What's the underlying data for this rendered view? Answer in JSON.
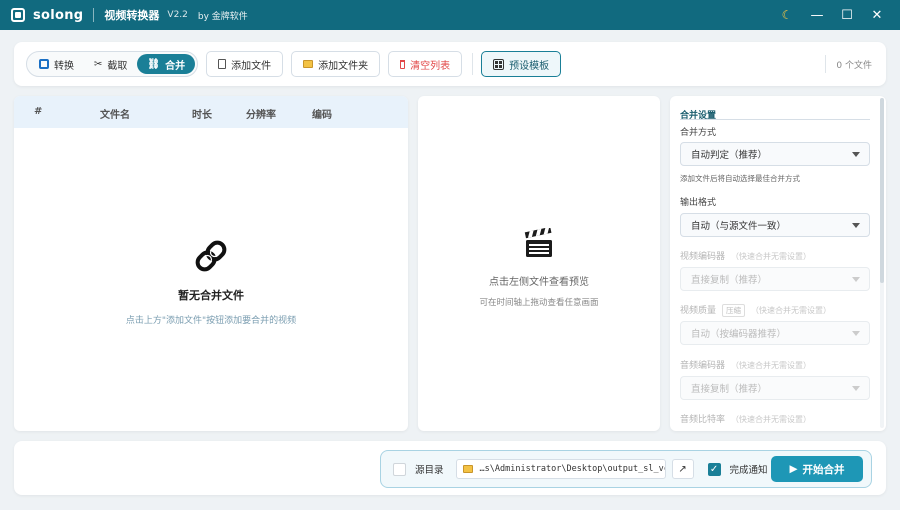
{
  "titlebar": {
    "brand": "solong",
    "app_title": "视频转换器",
    "version": "V2.2",
    "company": "by 金牌软件",
    "moon_icon": "☾",
    "min_icon": "—",
    "max_icon": "☐",
    "close_icon": "✕"
  },
  "toolbar": {
    "modes": [
      {
        "label": "转换",
        "icon": "convert-icon"
      },
      {
        "label": "截取",
        "icon": "scissors-icon",
        "glyph": "✂"
      },
      {
        "label": "合并",
        "icon": "link-icon",
        "glyph": "⛓",
        "active": true
      }
    ],
    "add_file": "添加文件",
    "add_folder": "添加文件夹",
    "clear_list": "清空列表",
    "preset_panel": "预设模板",
    "file_count": "0 个文件"
  },
  "file_list": {
    "columns": [
      "#",
      "文件名",
      "时长",
      "分辨率",
      "编码"
    ],
    "empty_title": "暂无合并文件",
    "empty_hint": "点击上方\"添加文件\"按钮添加要合并的视频"
  },
  "preview": {
    "title": "点击左侧文件查看预览",
    "hint": "可在时间轴上拖动查看任意画面"
  },
  "settings": {
    "section_title": "合并设置",
    "merge_mode_label": "合并方式",
    "merge_mode_value": "自动判定（推荐）",
    "merge_mode_note": "添加文件后将自动选择最佳合并方式",
    "output_format_label": "输出格式",
    "output_format_value": "自动（与源文件一致）",
    "video_encoder_label": "视频编码器",
    "video_encoder_hint": "（快速合并无需设置）",
    "video_encoder_value": "直接复制（推荐）",
    "video_quality_label": "视频质量",
    "video_quality_tag": "压缩",
    "video_quality_hint": "（快速合并无需设置）",
    "video_quality_value": "自动（按编码器推荐）",
    "audio_encoder_label": "音频编码器",
    "audio_encoder_hint": "（快速合并无需设置）",
    "audio_encoder_value": "直接复制（推荐）",
    "audio_bitrate_label": "音频比特率",
    "audio_bitrate_hint": "（快速合并无需设置）"
  },
  "bottom": {
    "source_dir_label": "源目录",
    "output_path": "…s\\Administrator\\Desktop\\output_sl_vc",
    "open_icon": "↗",
    "notify_label": "完成通知",
    "start_label": "开始合并"
  },
  "colors": {
    "titlebar": "#116a7f",
    "accent": "#1a7f97",
    "start_button": "#1e97b6",
    "danger": "#e24848"
  }
}
